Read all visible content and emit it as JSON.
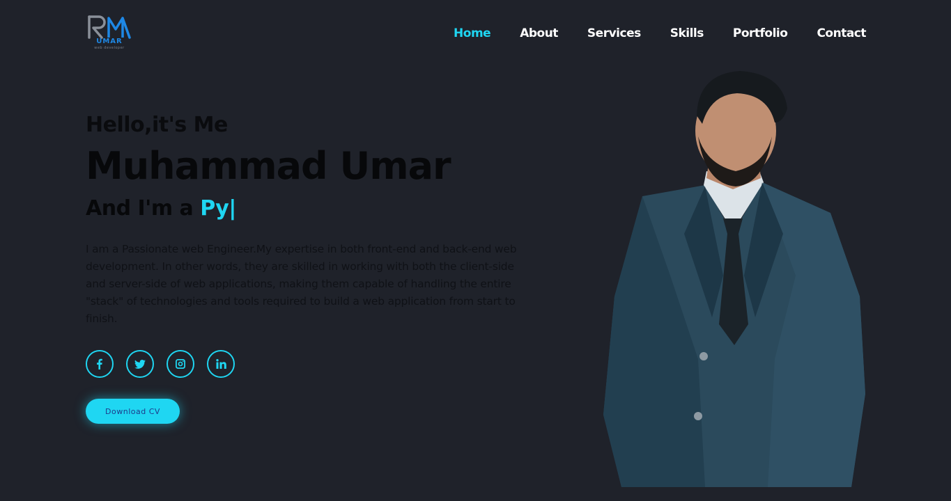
{
  "brand": {
    "logo_text": "UMAR",
    "logo_sub": "web developer"
  },
  "nav": {
    "items": [
      {
        "label": "Home",
        "active": true
      },
      {
        "label": "About",
        "active": false
      },
      {
        "label": "Services",
        "active": false
      },
      {
        "label": "Skills",
        "active": false
      },
      {
        "label": "Portfolio",
        "active": false
      },
      {
        "label": "Contact",
        "active": false
      }
    ]
  },
  "hero": {
    "greeting": "Hello,it's Me",
    "name": "Muhammad Umar",
    "role_prefix": "And I'm a ",
    "role_typed": "Py",
    "caret": "|",
    "bio": "I am a Passionate web Engineer.My expertise in both front-end and back-end web development. In other words, they are skilled in working with both the client-side and server-side of web applications, making them capable of handling the entire \"stack\" of technologies and tools required to build a web application from start to finish.",
    "socials": [
      {
        "icon": "facebook-icon"
      },
      {
        "icon": "twitter-icon"
      },
      {
        "icon": "instagram-icon"
      },
      {
        "icon": "linkedin-icon"
      }
    ],
    "cv_button": "Download CV"
  },
  "colors": {
    "background": "#1f222a",
    "accent": "#1fd6f2",
    "text_dark": "#07080a",
    "nav_text": "#ffffff"
  }
}
